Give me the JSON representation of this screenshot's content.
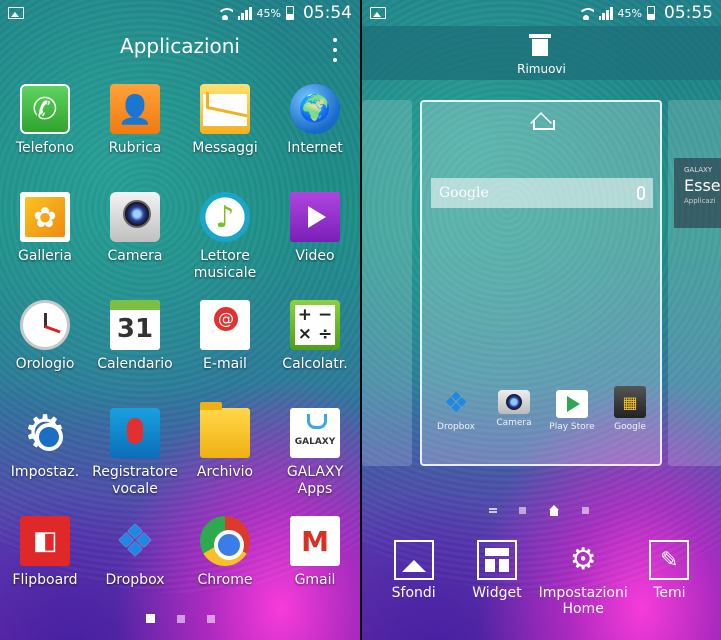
{
  "left": {
    "status": {
      "battery": "45%",
      "time": "05:54"
    },
    "header": {
      "title": "Applicazioni"
    },
    "apps": [
      {
        "label": "Telefono",
        "icon": "phone-icon"
      },
      {
        "label": "Rubrica",
        "icon": "contacts-icon"
      },
      {
        "label": "Messaggi",
        "icon": "messages-icon"
      },
      {
        "label": "Internet",
        "icon": "globe-icon"
      },
      {
        "label": "Galleria",
        "icon": "gallery-icon"
      },
      {
        "label": "Camera",
        "icon": "camera-icon"
      },
      {
        "label": "Lettore\nmusicale",
        "icon": "music-icon"
      },
      {
        "label": "Video",
        "icon": "video-icon"
      },
      {
        "label": "Orologio",
        "icon": "clock-icon"
      },
      {
        "label": "Calendario",
        "icon": "calendar-icon",
        "glyph": "31"
      },
      {
        "label": "E-mail",
        "icon": "email-icon"
      },
      {
        "label": "Calcolatr.",
        "icon": "calculator-icon",
        "glyph": "+ −\n× ÷"
      },
      {
        "label": "Impostaz.",
        "icon": "settings-icon"
      },
      {
        "label": "Registratore\nvocale",
        "icon": "voice-recorder-icon"
      },
      {
        "label": "Archivio",
        "icon": "folder-icon"
      },
      {
        "label": "GALAXY\nApps",
        "icon": "galaxy-apps-icon",
        "glyph": "GALAXY"
      },
      {
        "label": "Flipboard",
        "icon": "flipboard-icon"
      },
      {
        "label": "Dropbox",
        "icon": "dropbox-icon"
      },
      {
        "label": "Chrome",
        "icon": "chrome-icon"
      },
      {
        "label": "Gmail",
        "icon": "gmail-icon",
        "glyph": "M"
      }
    ],
    "pages": {
      "count": 3,
      "active": 0
    }
  },
  "right": {
    "status": {
      "battery": "45%",
      "time": "05:55"
    },
    "remove_label": "Rimuovi",
    "search_placeholder": "Google",
    "panel_apps": [
      {
        "label": "Dropbox",
        "icon": "dropbox-icon"
      },
      {
        "label": "Camera",
        "icon": "camera-icon"
      },
      {
        "label": "Play Store",
        "icon": "play-store-icon"
      },
      {
        "label": "Google",
        "icon": "google-folder-icon"
      }
    ],
    "galaxy_card": {
      "brand": "GALAXY",
      "title": "Esse",
      "subtitle": "Applicazi"
    },
    "edit_options": [
      {
        "label": "Sfondi",
        "icon": "wallpaper-icon"
      },
      {
        "label": "Widget",
        "icon": "widget-icon"
      },
      {
        "label": "Impostazioni\nHome",
        "icon": "home-settings-icon"
      },
      {
        "label": "Temi",
        "icon": "themes-icon"
      }
    ]
  }
}
